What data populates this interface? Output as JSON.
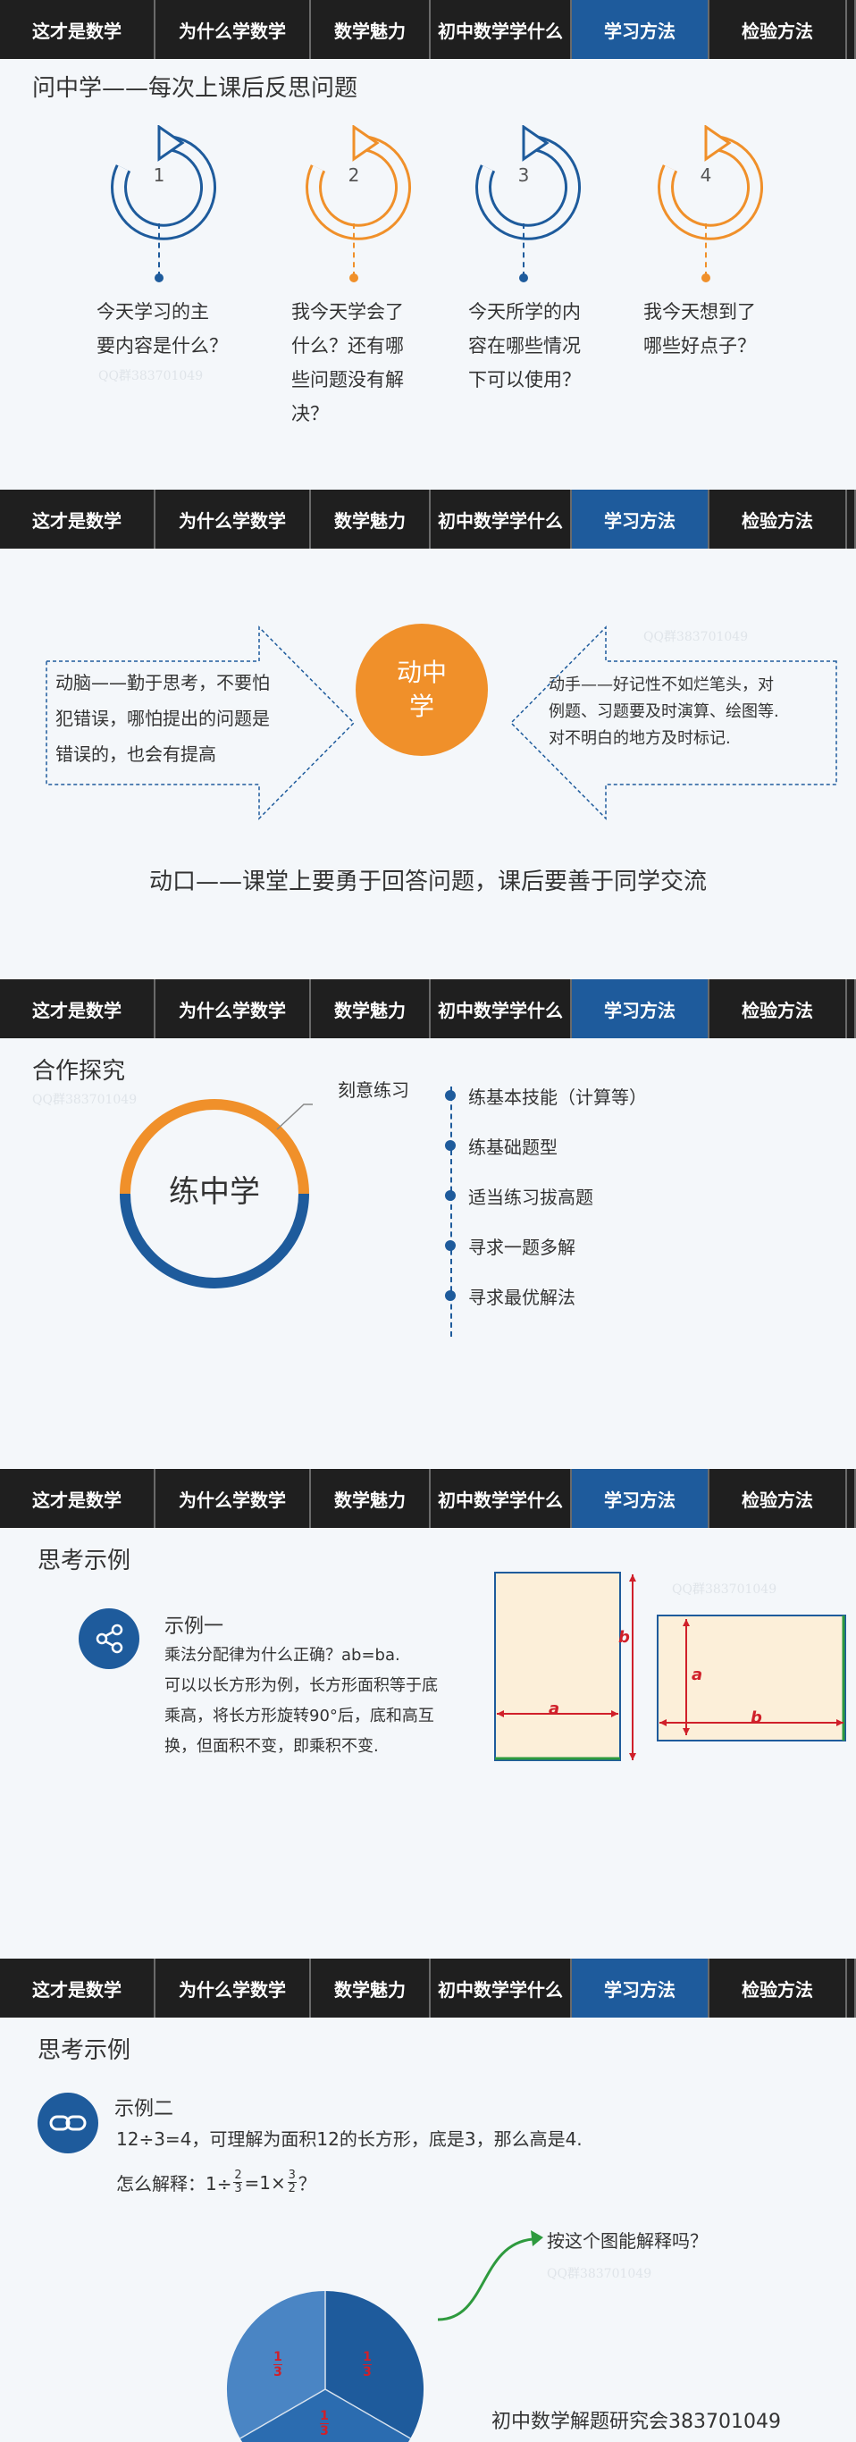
{
  "nav": {
    "tabs": [
      "这才是数学",
      "为什么学数学",
      "数学魅力",
      "初中数学学什么",
      "学习方法",
      "检验方法"
    ],
    "active_index": 4
  },
  "watermark": "QQ群383701049",
  "slide1": {
    "title": "问中学——每次上课后反思问题",
    "steps": [
      {
        "num": "1",
        "lines": [
          "今天学习的主",
          "要内容是什么？"
        ]
      },
      {
        "num": "2",
        "lines": [
          "我今天学会了",
          "什么？还有哪",
          "些问题没有解",
          "决？"
        ]
      },
      {
        "num": "3",
        "lines": [
          "今天所学的内",
          "容在哪些情况",
          "下可以使用？"
        ]
      },
      {
        "num": "4",
        "lines": [
          "我今天想到了",
          "哪些好点子？"
        ]
      }
    ],
    "colors": [
      "#1e5b9c",
      "#f0902a",
      "#1e5b9c",
      "#f0902a"
    ]
  },
  "slide2": {
    "left_lines": [
      "动脑——勤于思考，不要怕",
      "犯错误，哪怕提出的问题是",
      "错误的，也会有提高"
    ],
    "center_lines": [
      "动中",
      "学"
    ],
    "right_lines": [
      "动手——好记性不如烂笔头，对",
      "例题、习题要及时演算、绘图等.",
      "对不明白的地方及时标记."
    ],
    "bottom": "动口——课堂上要勇于回答问题，课后要善于同学交流"
  },
  "slide3": {
    "title": "合作探究",
    "ring_label": "练中学",
    "callout": "刻意练习",
    "items": [
      "练基本技能（计算等）",
      "练基础题型",
      "适当练习拔高题",
      "寻求一题多解",
      "寻求最优解法"
    ]
  },
  "slide4": {
    "title": "思考示例",
    "example_head": "示例一",
    "lines": [
      "乘法分配律为什么正确？ab=ba.",
      "可以以长方形为例，长方形面积等于底",
      "乘高，将长方形旋转90°后，底和高互",
      "换，但面积不变，即乘积不变."
    ],
    "fig_labels": {
      "a1": "a",
      "b1": "b",
      "a2": "a",
      "b2": "b"
    }
  },
  "slide5": {
    "title": "思考示例",
    "example_head": "示例二",
    "line1": "12÷3=4，可理解为面积12的长方形，底是3，那么高是4.",
    "line2_prefix": "怎么解释：1÷",
    "line2_frac1": [
      "2",
      "3"
    ],
    "line2_mid": "=1×",
    "line2_frac2": [
      "3",
      "2"
    ],
    "line2_suffix": "？",
    "pie_labels": [
      "1",
      "3",
      "1",
      "3",
      "1",
      "3"
    ],
    "callout": "按这个图能解释吗？",
    "footer": "初中数学解题研究会383701049"
  }
}
